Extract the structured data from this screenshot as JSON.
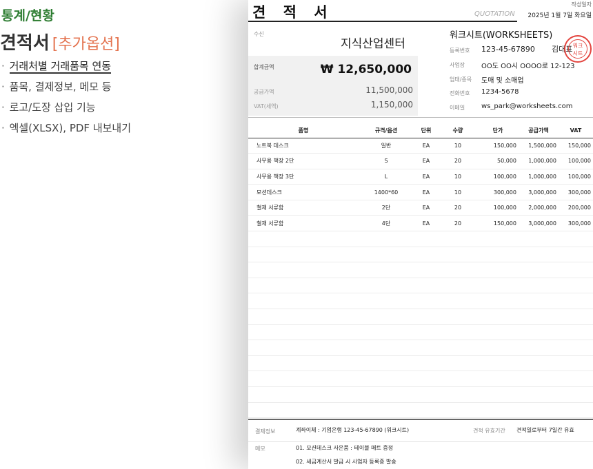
{
  "promo": {
    "category": "통계/현황",
    "title": "견적서",
    "option": "[추가옵션]",
    "features": [
      "거래처별 거래품목 연동",
      "품목, 결제정보, 메모 등",
      "로고/도장 삽입 기능",
      "엑셀(XLSX), PDF 내보내기"
    ]
  },
  "doc": {
    "title": "견 적 서",
    "title_en": "QUOTATION",
    "date_label": "작성일자",
    "date": "2025년 1월 7일 화요일",
    "receiver_label": "수신",
    "receiver": "지식산업센터",
    "total_label": "합계금액",
    "total": "₩  12,650,000",
    "supply_label": "공급가액",
    "supply": "11,500,000",
    "vat_label": "VAT(세액)",
    "vat": "1,150,000",
    "supplier": {
      "name": "워크시트(WORKSHEETS)",
      "reg_label": "등록번호",
      "reg": "123-45-67890",
      "rep": "김대표",
      "stamp_text": "워크시트 직인",
      "addr_label": "사업장",
      "addr": "OO도 OO시 OOOO로 12-123",
      "biz_label": "업태/종목",
      "biz": "도매 및 소매업",
      "tel_label": "전화번호",
      "tel": "1234-5678",
      "email_label": "이메일",
      "email": "ws_park@worksheets.com"
    },
    "table": {
      "headers": {
        "name": "품명",
        "spec": "규격/옵션",
        "unit": "단위",
        "qty": "수량",
        "price": "단가",
        "amount": "공급가액",
        "vat": "VAT"
      },
      "rows": [
        {
          "name": "노트북 데스크",
          "spec": "일반",
          "unit": "EA",
          "qty": "10",
          "price": "150,000",
          "amount": "1,500,000",
          "vat": "150,000"
        },
        {
          "name": "사무용 책장 2단",
          "spec": "S",
          "unit": "EA",
          "qty": "20",
          "price": "50,000",
          "amount": "1,000,000",
          "vat": "100,000"
        },
        {
          "name": "사무용 책장 3단",
          "spec": "L",
          "unit": "EA",
          "qty": "10",
          "price": "100,000",
          "amount": "1,000,000",
          "vat": "100,000"
        },
        {
          "name": "모션데스크",
          "spec": "1400*60",
          "unit": "EA",
          "qty": "10",
          "price": "300,000",
          "amount": "3,000,000",
          "vat": "300,000"
        },
        {
          "name": "철재 서류함",
          "spec": "2단",
          "unit": "EA",
          "qty": "20",
          "price": "100,000",
          "amount": "2,000,000",
          "vat": "200,000"
        },
        {
          "name": "철재 서류함",
          "spec": "4단",
          "unit": "EA",
          "qty": "20",
          "price": "150,000",
          "amount": "3,000,000",
          "vat": "300,000"
        },
        {
          "name": "",
          "spec": "",
          "unit": "",
          "qty": "",
          "price": "",
          "amount": "",
          "vat": ""
        },
        {
          "name": "",
          "spec": "",
          "unit": "",
          "qty": "",
          "price": "",
          "amount": "",
          "vat": ""
        },
        {
          "name": "",
          "spec": "",
          "unit": "",
          "qty": "",
          "price": "",
          "amount": "",
          "vat": ""
        },
        {
          "name": "",
          "spec": "",
          "unit": "",
          "qty": "",
          "price": "",
          "amount": "",
          "vat": ""
        },
        {
          "name": "",
          "spec": "",
          "unit": "",
          "qty": "",
          "price": "",
          "amount": "",
          "vat": ""
        },
        {
          "name": "",
          "spec": "",
          "unit": "",
          "qty": "",
          "price": "",
          "amount": "",
          "vat": ""
        },
        {
          "name": "",
          "spec": "",
          "unit": "",
          "qty": "",
          "price": "",
          "amount": "",
          "vat": ""
        },
        {
          "name": "",
          "spec": "",
          "unit": "",
          "qty": "",
          "price": "",
          "amount": "",
          "vat": ""
        },
        {
          "name": "",
          "spec": "",
          "unit": "",
          "qty": "",
          "price": "",
          "amount": "",
          "vat": ""
        },
        {
          "name": "",
          "spec": "",
          "unit": "",
          "qty": "",
          "price": "",
          "amount": "",
          "vat": ""
        },
        {
          "name": "",
          "spec": "",
          "unit": "",
          "qty": "",
          "price": "",
          "amount": "",
          "vat": ""
        },
        {
          "name": "",
          "spec": "",
          "unit": "",
          "qty": "",
          "price": "",
          "amount": "",
          "vat": ""
        }
      ]
    },
    "payment_label": "결제정보",
    "payment": "계좌이체 : 기업은행 123-45-67890 (워크시트)",
    "valid_label": "견적 유효기간",
    "valid": "견적일로부터 7일간 유효",
    "memo_label": "메모",
    "memo": [
      "01. 모션데스크 사은품 : 테이블 매트 증정",
      "02. 세금계산서 발급 시 사업자 등록증 발송"
    ]
  },
  "colors": {
    "category_green": "#2e7d32",
    "option_orange": "#e4734f",
    "stamp_red": "#e0302a"
  }
}
